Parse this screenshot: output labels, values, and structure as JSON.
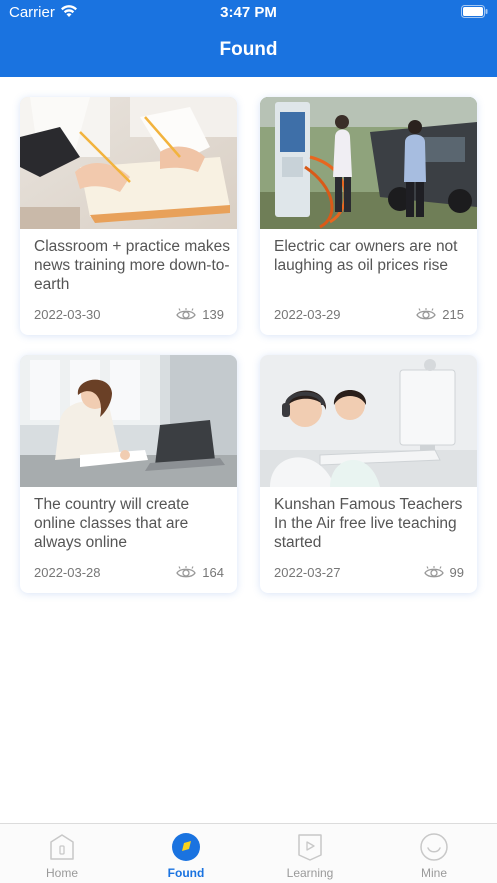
{
  "status_bar": {
    "carrier": "Carrier",
    "time": "3:47 PM"
  },
  "header": {
    "title": "Found"
  },
  "colors": {
    "primary": "#1a73e0",
    "card_shadow": "#5082dc"
  },
  "articles": [
    {
      "title": "Classroom + practice makes news training more down-to-earth",
      "date": "2022-03-30",
      "views": "139",
      "image": "students-writing-photo"
    },
    {
      "title": "Electric car owners are not laughing as oil prices rise",
      "date": "2022-03-29",
      "views": "215",
      "image": "ev-charging-station-photo"
    },
    {
      "title": "The country will create online classes that are always online",
      "date": "2022-03-28",
      "views": "164",
      "image": "girl-studying-laptop-photo"
    },
    {
      "title": "Kunshan Famous Teachers In the Air free live teaching started",
      "date": "2022-03-27",
      "views": "99",
      "image": "kids-computer-class-photo"
    }
  ],
  "tabs": [
    {
      "label": "Home",
      "icon": "home-icon",
      "active": false
    },
    {
      "label": "Found",
      "icon": "found-icon",
      "active": true
    },
    {
      "label": "Learning",
      "icon": "learning-icon",
      "active": false
    },
    {
      "label": "Mine",
      "icon": "mine-icon",
      "active": false
    }
  ]
}
